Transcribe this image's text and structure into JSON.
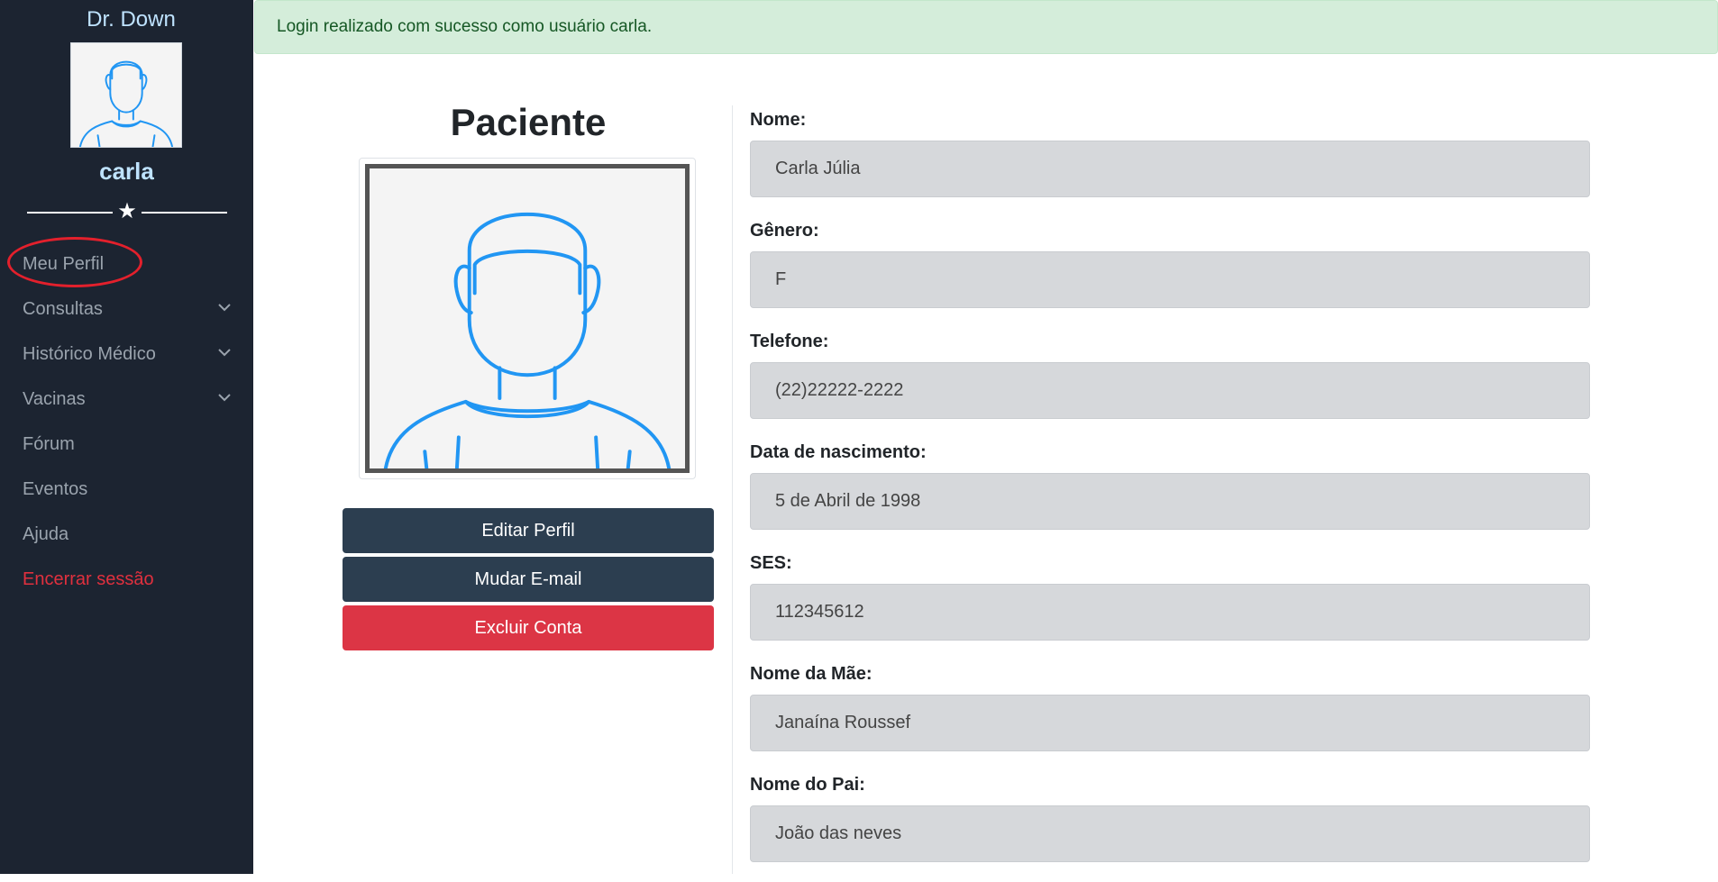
{
  "sidebar": {
    "brand": "Dr. Down",
    "username": "carla",
    "avatar_icon": "user-avatar-icon",
    "items": [
      {
        "label": "Meu Perfil"
      },
      {
        "label": "Consultas",
        "icon": "chevron-down-icon"
      },
      {
        "label": "Histórico Médico",
        "icon": "chevron-down-icon"
      },
      {
        "label": "Vacinas",
        "icon": "chevron-down-icon"
      },
      {
        "label": "Fórum"
      },
      {
        "label": "Eventos"
      },
      {
        "label": "Ajuda"
      },
      {
        "label": "Encerrar sessão"
      }
    ]
  },
  "alert": {
    "message": "Login realizado com sucesso como usuário carla."
  },
  "profile": {
    "title": "Paciente",
    "buttons": {
      "edit": "Editar Perfil",
      "email": "Mudar E-mail",
      "delete": "Excluir Conta"
    }
  },
  "fields": [
    {
      "label": "Nome:",
      "value": "Carla Júlia"
    },
    {
      "label": "Gênero:",
      "value": "F"
    },
    {
      "label": "Telefone:",
      "value": "(22)22222-2222"
    },
    {
      "label": "Data de nascimento:",
      "value": "5 de Abril de 1998"
    },
    {
      "label": "SES:",
      "value": "112345612"
    },
    {
      "label": "Nome da Mãe:",
      "value": "Janaína Roussef"
    },
    {
      "label": "Nome do Pai:",
      "value": "João das neves"
    }
  ],
  "colors": {
    "sidebar_bg": "#1c2431",
    "accent_blue": "#2196f3",
    "danger": "#dc3545",
    "button_dark": "#2c3e50",
    "alert_bg": "#d4edda"
  }
}
